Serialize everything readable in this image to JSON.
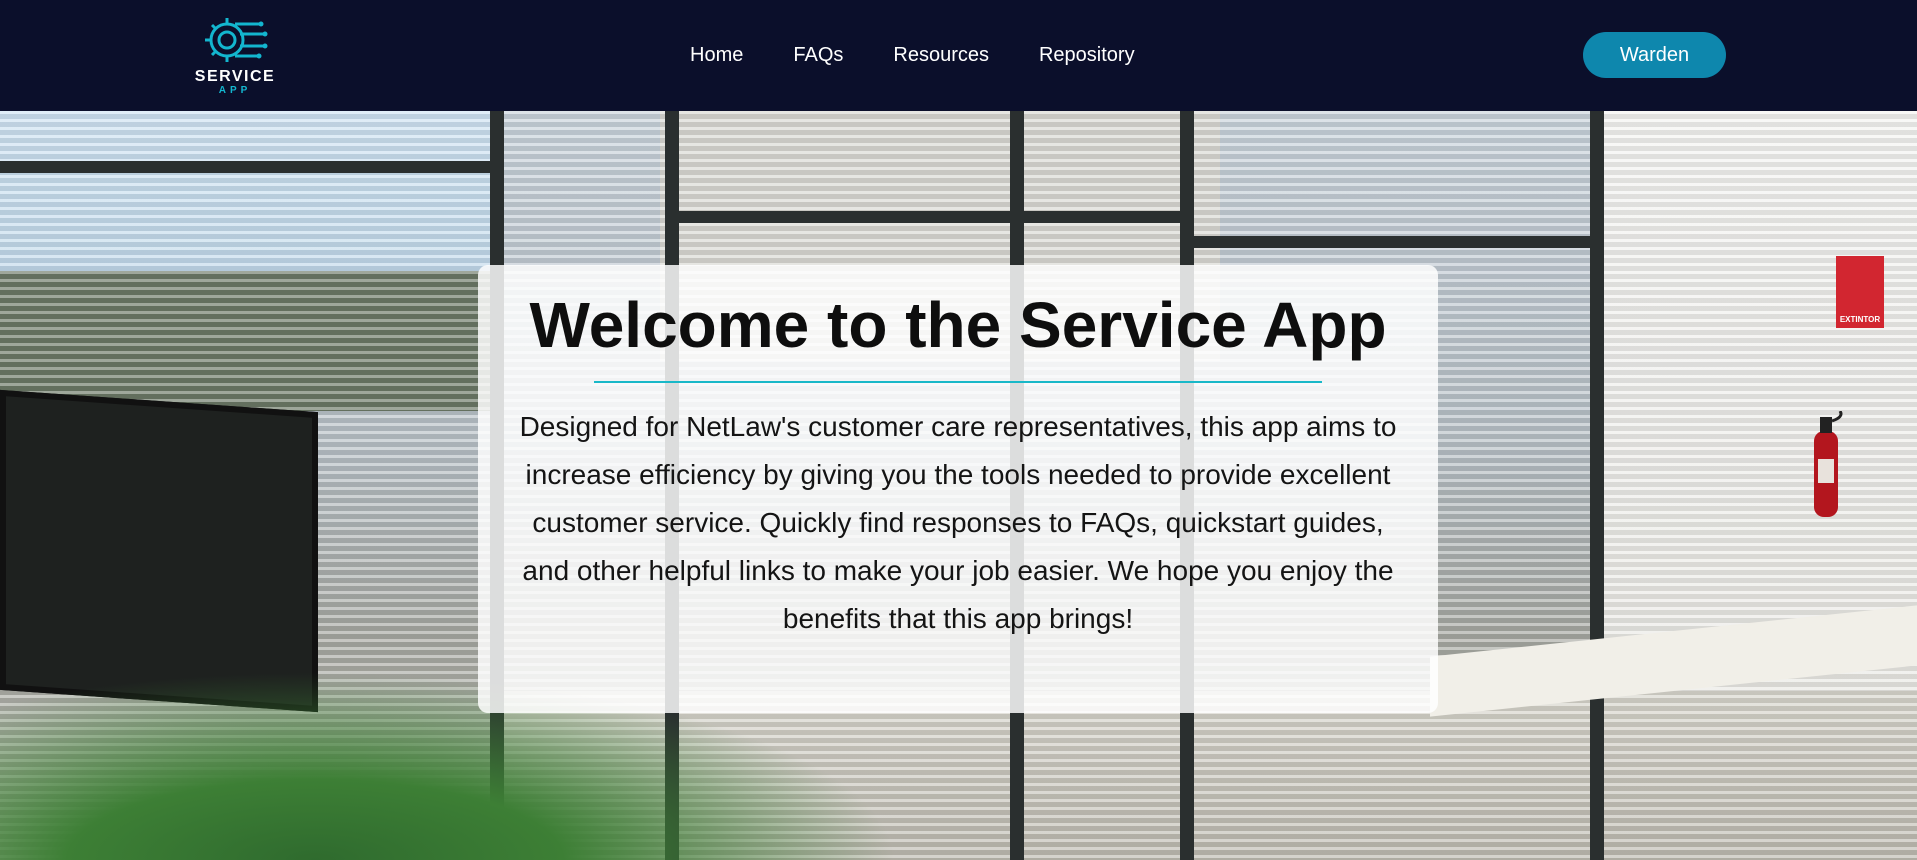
{
  "brand": {
    "name": "SERVICE",
    "sub": "APP",
    "logo_icon": "gear-circuit-icon",
    "accent_color": "#13b6cf",
    "navbar_bg": "#0b0f2b"
  },
  "nav": {
    "links": [
      "Home",
      "FAQs",
      "Resources",
      "Repository"
    ]
  },
  "cta": {
    "label": "Warden",
    "color": "#0e87ad"
  },
  "hero": {
    "background": "office-meeting-room-photo",
    "sign_text": "EXTINTOR",
    "title": "Welcome to the Service App",
    "body": "Designed for NetLaw's customer care representatives, this app aims to increase efficiency by giving you the tools needed to provide excellent customer service. Quickly find responses to FAQs, quickstart guides, and other helpful links to make your job easier. We hope you enjoy the benefits that this app brings!"
  }
}
